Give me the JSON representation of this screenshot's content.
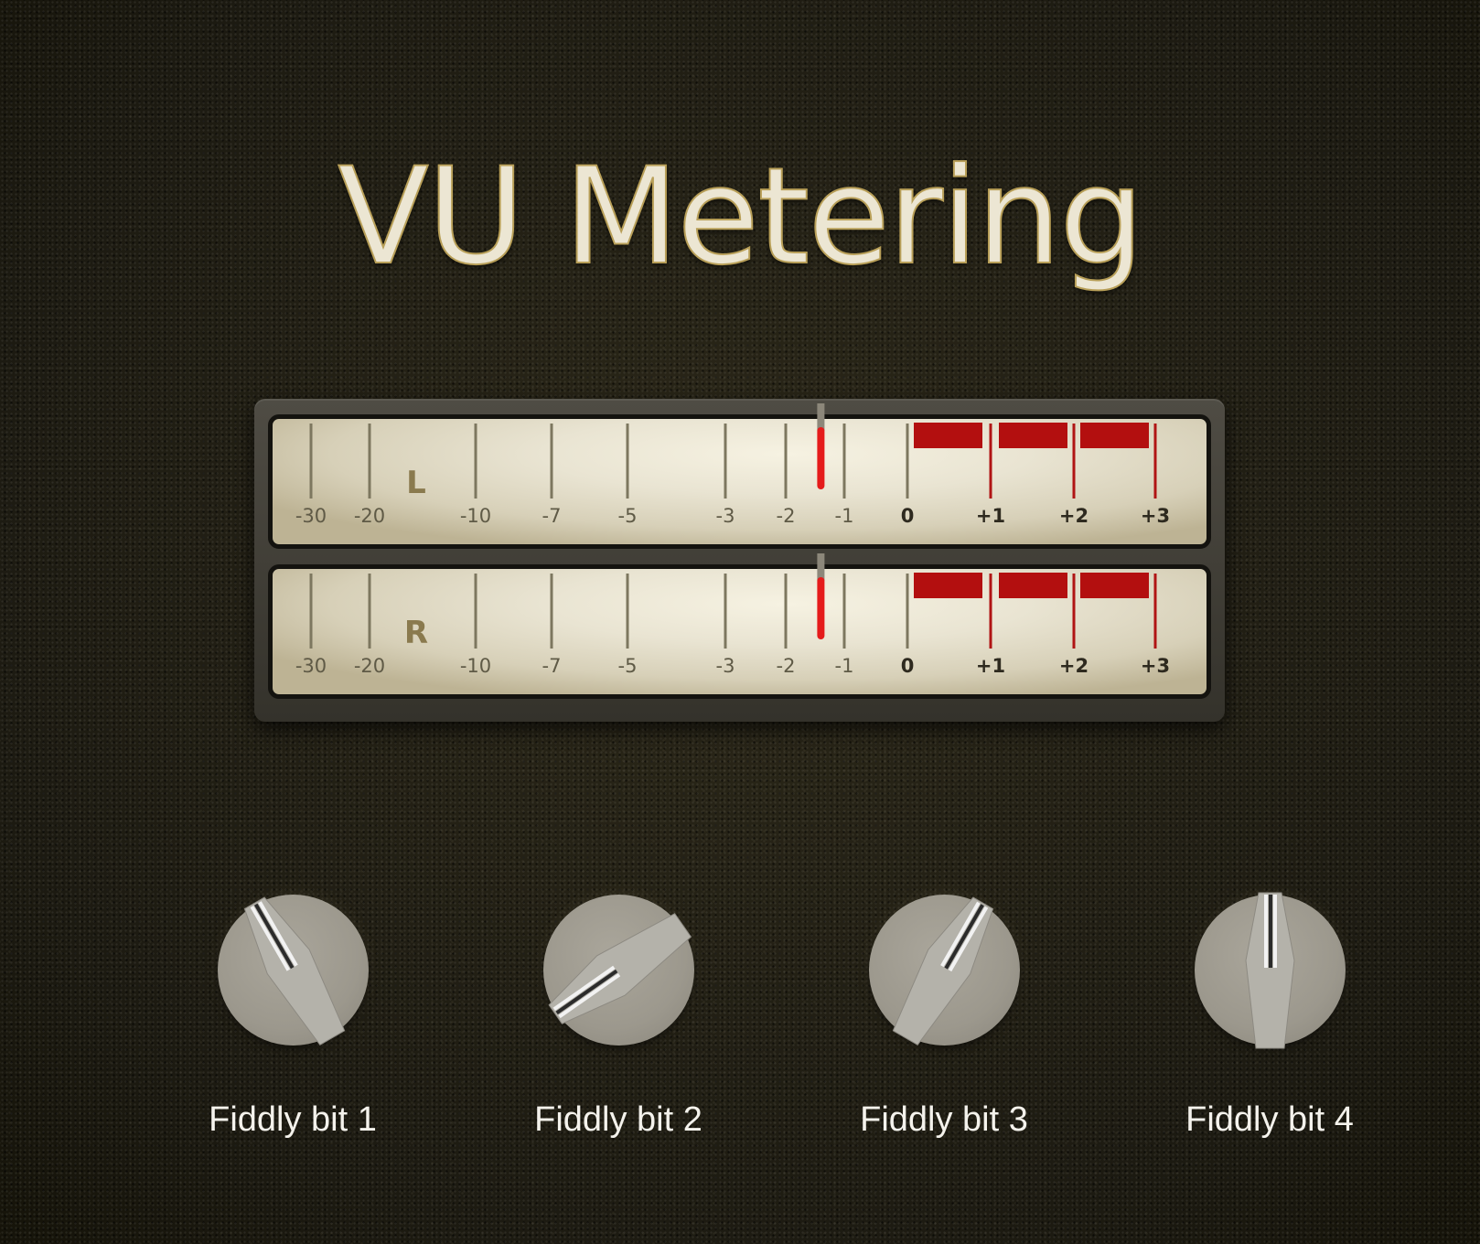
{
  "title": "VU Metering",
  "scale": {
    "ticks": [
      -30,
      -20,
      -10,
      -7,
      -5,
      -3,
      -2,
      -1,
      0,
      1,
      2,
      3
    ],
    "labels": [
      "-30",
      "-20",
      "-10",
      "-7",
      "-5",
      "-3",
      "-2",
      "-1",
      "0",
      "+1",
      "+2",
      "+3"
    ]
  },
  "meters": [
    {
      "channel": "L",
      "level_db": -1.4
    },
    {
      "channel": "R",
      "level_db": -1.4
    }
  ],
  "knobs": [
    {
      "label": "Fiddly bit 1",
      "angle_deg": -30
    },
    {
      "label": "Fiddly bit 2",
      "angle_deg": -125
    },
    {
      "label": "Fiddly bit 3",
      "angle_deg": 30
    },
    {
      "label": "Fiddly bit 4",
      "angle_deg": 0
    }
  ],
  "colors": {
    "title": "#ece6d3",
    "red_zone": "#b30f0f",
    "needle": "#e51b1b",
    "meter_face": "#e9e4d2",
    "knob": "#9c988d"
  }
}
